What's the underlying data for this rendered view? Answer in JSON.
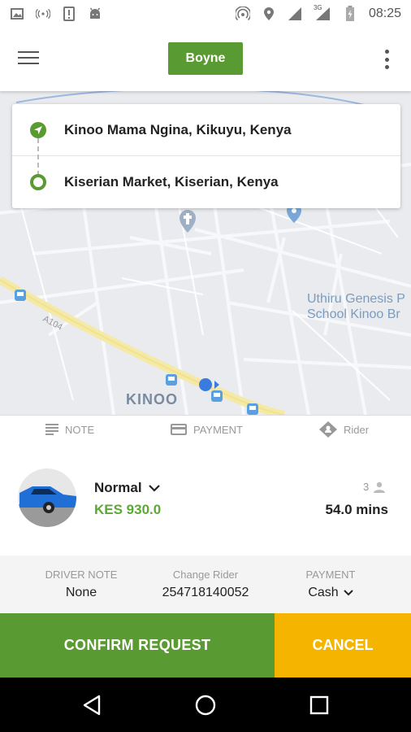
{
  "status_bar": {
    "time": "08:25",
    "network_label": "3G",
    "icons": [
      "image-icon",
      "wifi-hotspot-icon",
      "alert-icon",
      "android-icon",
      "hotspot-icon",
      "location-icon",
      "signal-icon",
      "signal-3g-icon",
      "battery-charging-icon"
    ]
  },
  "header": {
    "brand_button_label": "Boyne",
    "menu_icon": "hamburger-menu-icon",
    "more_icon": "more-vert-icon"
  },
  "route": {
    "pickup": "Kinoo Mama Ngina, Kikuyu, Kenya",
    "dropoff": "Kiserian Market, Kiserian, Kenya"
  },
  "map": {
    "area_label": "KINOO",
    "road_label": "A104",
    "poi_label_line1": "Uthiru Genesis P",
    "poi_label_line2": "School Kinoo Br"
  },
  "options": {
    "note_label": "NOTE",
    "payment_label": "PAYMENT",
    "rider_label": "Rider"
  },
  "ride": {
    "type": "Normal",
    "price": "KES 930.0",
    "seats": "3",
    "eta": "54.0 mins"
  },
  "details": {
    "driver_note_label": "DRIVER NOTE",
    "driver_note_value": "None",
    "change_rider_label": "Change Rider",
    "change_rider_value": "254718140052",
    "payment_label": "PAYMENT",
    "payment_value": "Cash"
  },
  "actions": {
    "confirm_label": "CONFIRM REQUEST",
    "cancel_label": "CANCEL"
  },
  "colors": {
    "brand_green": "#5a9a32",
    "price_green": "#5aaa32",
    "cancel_yellow": "#f5b400",
    "map_background": "#e9ebee"
  }
}
